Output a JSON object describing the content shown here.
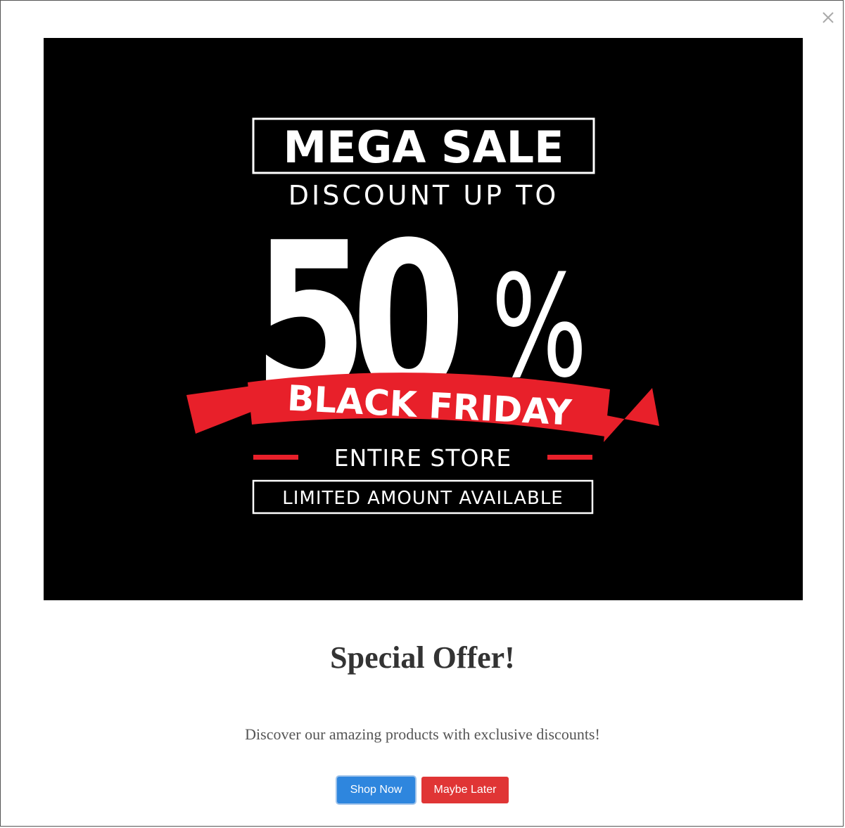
{
  "modal": {
    "close_icon": "close-icon",
    "banner": {
      "title": "MEGA SALE",
      "discount_line": "DISCOUNT UP TO",
      "percent_value": "50",
      "percent_sign": "%",
      "ribbon_text": "BLACK FRIDAY",
      "entire_store": "ENTIRE STORE",
      "limited": "LIMITED AMOUNT AVAILABLE",
      "colors": {
        "background": "#000000",
        "text": "#ffffff",
        "ribbon": "#e8202a"
      }
    },
    "headline": "Special Offer!",
    "description": "Discover our amazing products with exclusive discounts!",
    "buttons": {
      "primary_label": "Shop Now",
      "secondary_label": "Maybe Later"
    },
    "colors": {
      "primary_button": "#2e86de",
      "secondary_button": "#e03535",
      "headline": "#333333"
    }
  }
}
